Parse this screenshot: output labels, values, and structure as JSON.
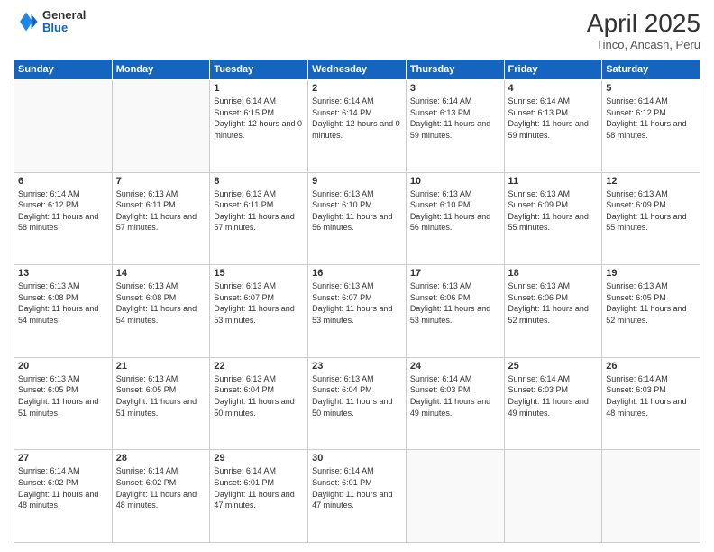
{
  "header": {
    "logo": {
      "general": "General",
      "blue": "Blue"
    },
    "title": "April 2025",
    "subtitle": "Tinco, Ancash, Peru"
  },
  "calendar": {
    "days_of_week": [
      "Sunday",
      "Monday",
      "Tuesday",
      "Wednesday",
      "Thursday",
      "Friday",
      "Saturday"
    ],
    "weeks": [
      [
        {
          "day": "",
          "info": ""
        },
        {
          "day": "",
          "info": ""
        },
        {
          "day": "1",
          "info": "Sunrise: 6:14 AM\nSunset: 6:15 PM\nDaylight: 12 hours and 0 minutes."
        },
        {
          "day": "2",
          "info": "Sunrise: 6:14 AM\nSunset: 6:14 PM\nDaylight: 12 hours and 0 minutes."
        },
        {
          "day": "3",
          "info": "Sunrise: 6:14 AM\nSunset: 6:13 PM\nDaylight: 11 hours and 59 minutes."
        },
        {
          "day": "4",
          "info": "Sunrise: 6:14 AM\nSunset: 6:13 PM\nDaylight: 11 hours and 59 minutes."
        },
        {
          "day": "5",
          "info": "Sunrise: 6:14 AM\nSunset: 6:12 PM\nDaylight: 11 hours and 58 minutes."
        }
      ],
      [
        {
          "day": "6",
          "info": "Sunrise: 6:14 AM\nSunset: 6:12 PM\nDaylight: 11 hours and 58 minutes."
        },
        {
          "day": "7",
          "info": "Sunrise: 6:13 AM\nSunset: 6:11 PM\nDaylight: 11 hours and 57 minutes."
        },
        {
          "day": "8",
          "info": "Sunrise: 6:13 AM\nSunset: 6:11 PM\nDaylight: 11 hours and 57 minutes."
        },
        {
          "day": "9",
          "info": "Sunrise: 6:13 AM\nSunset: 6:10 PM\nDaylight: 11 hours and 56 minutes."
        },
        {
          "day": "10",
          "info": "Sunrise: 6:13 AM\nSunset: 6:10 PM\nDaylight: 11 hours and 56 minutes."
        },
        {
          "day": "11",
          "info": "Sunrise: 6:13 AM\nSunset: 6:09 PM\nDaylight: 11 hours and 55 minutes."
        },
        {
          "day": "12",
          "info": "Sunrise: 6:13 AM\nSunset: 6:09 PM\nDaylight: 11 hours and 55 minutes."
        }
      ],
      [
        {
          "day": "13",
          "info": "Sunrise: 6:13 AM\nSunset: 6:08 PM\nDaylight: 11 hours and 54 minutes."
        },
        {
          "day": "14",
          "info": "Sunrise: 6:13 AM\nSunset: 6:08 PM\nDaylight: 11 hours and 54 minutes."
        },
        {
          "day": "15",
          "info": "Sunrise: 6:13 AM\nSunset: 6:07 PM\nDaylight: 11 hours and 53 minutes."
        },
        {
          "day": "16",
          "info": "Sunrise: 6:13 AM\nSunset: 6:07 PM\nDaylight: 11 hours and 53 minutes."
        },
        {
          "day": "17",
          "info": "Sunrise: 6:13 AM\nSunset: 6:06 PM\nDaylight: 11 hours and 53 minutes."
        },
        {
          "day": "18",
          "info": "Sunrise: 6:13 AM\nSunset: 6:06 PM\nDaylight: 11 hours and 52 minutes."
        },
        {
          "day": "19",
          "info": "Sunrise: 6:13 AM\nSunset: 6:05 PM\nDaylight: 11 hours and 52 minutes."
        }
      ],
      [
        {
          "day": "20",
          "info": "Sunrise: 6:13 AM\nSunset: 6:05 PM\nDaylight: 11 hours and 51 minutes."
        },
        {
          "day": "21",
          "info": "Sunrise: 6:13 AM\nSunset: 6:05 PM\nDaylight: 11 hours and 51 minutes."
        },
        {
          "day": "22",
          "info": "Sunrise: 6:13 AM\nSunset: 6:04 PM\nDaylight: 11 hours and 50 minutes."
        },
        {
          "day": "23",
          "info": "Sunrise: 6:13 AM\nSunset: 6:04 PM\nDaylight: 11 hours and 50 minutes."
        },
        {
          "day": "24",
          "info": "Sunrise: 6:14 AM\nSunset: 6:03 PM\nDaylight: 11 hours and 49 minutes."
        },
        {
          "day": "25",
          "info": "Sunrise: 6:14 AM\nSunset: 6:03 PM\nDaylight: 11 hours and 49 minutes."
        },
        {
          "day": "26",
          "info": "Sunrise: 6:14 AM\nSunset: 6:03 PM\nDaylight: 11 hours and 48 minutes."
        }
      ],
      [
        {
          "day": "27",
          "info": "Sunrise: 6:14 AM\nSunset: 6:02 PM\nDaylight: 11 hours and 48 minutes."
        },
        {
          "day": "28",
          "info": "Sunrise: 6:14 AM\nSunset: 6:02 PM\nDaylight: 11 hours and 48 minutes."
        },
        {
          "day": "29",
          "info": "Sunrise: 6:14 AM\nSunset: 6:01 PM\nDaylight: 11 hours and 47 minutes."
        },
        {
          "day": "30",
          "info": "Sunrise: 6:14 AM\nSunset: 6:01 PM\nDaylight: 11 hours and 47 minutes."
        },
        {
          "day": "",
          "info": ""
        },
        {
          "day": "",
          "info": ""
        },
        {
          "day": "",
          "info": ""
        }
      ]
    ]
  }
}
